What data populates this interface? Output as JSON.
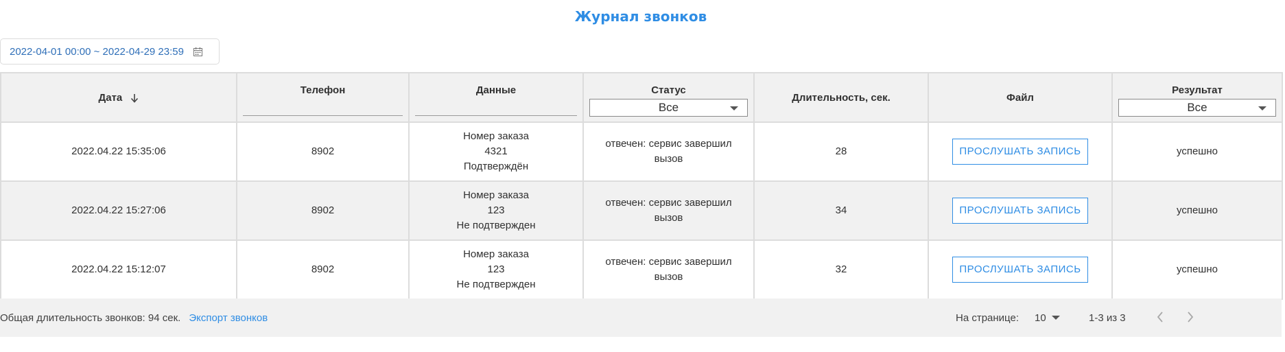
{
  "title": "Журнал звонков",
  "date_range": {
    "value": "2022-04-01 00:00 ~ 2022-04-29 23:59",
    "icon": "calendar-icon"
  },
  "columns": {
    "date": "Дата",
    "phone": "Телефон",
    "data": "Данные",
    "status": "Статус",
    "duration": "Длительность, сек.",
    "file": "Файл",
    "result": "Результат"
  },
  "filters": {
    "status_selected": "Все",
    "result_selected": "Все"
  },
  "rows": [
    {
      "date": "2022.04.22 15:35:06",
      "phone": "8902",
      "data_line1": "Номер заказа",
      "data_line2": "4321",
      "data_line3": "Подтверждён",
      "status_line1": "отвечен: сервис завершил",
      "status_line2": "вызов",
      "duration": "28",
      "file_button": "ПРОСЛУШАТЬ ЗАПИСЬ",
      "result": "успешно"
    },
    {
      "date": "2022.04.22 15:27:06",
      "phone": "8902",
      "data_line1": "Номер заказа",
      "data_line2": "123",
      "data_line3": "Не подтвержден",
      "status_line1": "отвечен: сервис завершил",
      "status_line2": "вызов",
      "duration": "34",
      "file_button": "ПРОСЛУШАТЬ ЗАПИСЬ",
      "result": "успешно"
    },
    {
      "date": "2022.04.22 15:12:07",
      "phone": "8902",
      "data_line1": "Номер заказа",
      "data_line2": "123",
      "data_line3": "Не подтвержден",
      "status_line1": "отвечен: сервис завершил",
      "status_line2": "вызов",
      "duration": "32",
      "file_button": "ПРОСЛУШАТЬ ЗАПИСЬ",
      "result": "успешно"
    }
  ],
  "footer": {
    "total": "Общая длительность звонков: 94 сек.",
    "export": "Экспорт звонков",
    "per_page_label": "На странице:",
    "per_page_value": "10",
    "range": "1-3 из 3"
  },
  "colors": {
    "accent": "#2f8de4",
    "header_bg": "#f1f1f1",
    "border": "#dcdcdc"
  }
}
